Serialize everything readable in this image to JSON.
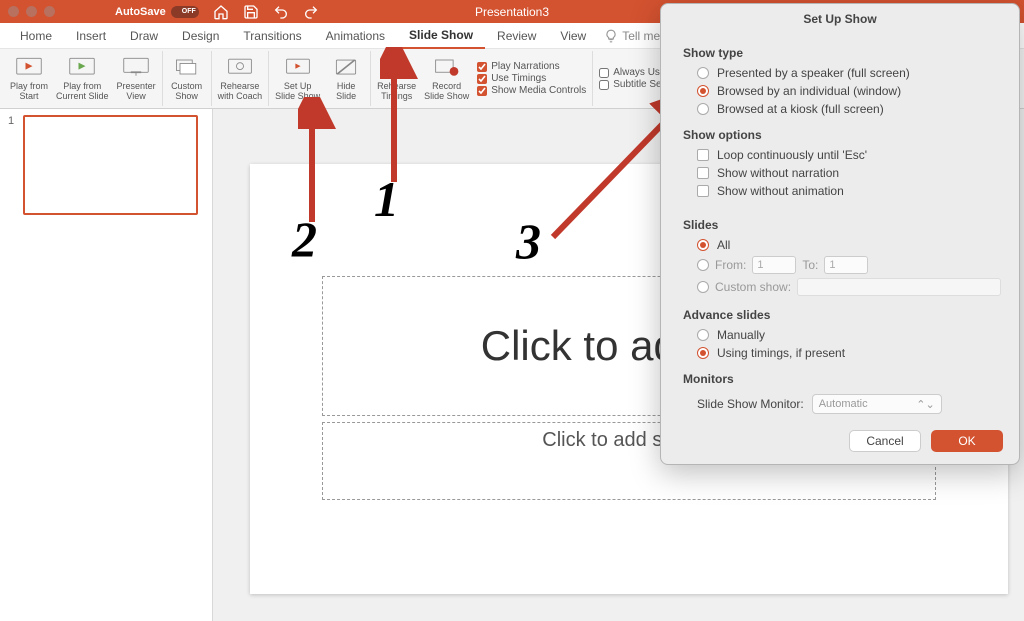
{
  "titlebar": {
    "autosave_label": "AutoSave",
    "autosave_state": "OFF",
    "doc_title": "Presentation3"
  },
  "menu": {
    "tabs": [
      "Home",
      "Insert",
      "Draw",
      "Design",
      "Transitions",
      "Animations",
      "Slide Show",
      "Review",
      "View"
    ],
    "active_index": 6,
    "tell_me": "Tell me"
  },
  "ribbon": {
    "play_from_start": "Play from\nStart",
    "play_from_current": "Play from\nCurrent Slide",
    "presenter_view": "Presenter\nView",
    "custom_show": "Custom\nShow",
    "rehearse_coach": "Rehearse\nwith Coach",
    "set_up": "Set Up\nSlide Show",
    "hide_slide": "Hide\nSlide",
    "rehearse_timings": "Rehearse\nTimings",
    "record": "Record\nSlide Show",
    "chk_narrations": "Play Narrations",
    "chk_timings": "Use Timings",
    "chk_media": "Show Media Controls",
    "chk_always": "Always Use",
    "chk_subtitle": "Subtitle Se"
  },
  "thumb": {
    "num": "1"
  },
  "canvas": {
    "title_placeholder": "Click to add title",
    "subtitle_placeholder": "Click to add subtitle"
  },
  "dialog": {
    "title": "Set Up Show",
    "show_type_hd": "Show type",
    "st_1": "Presented by a speaker (full screen)",
    "st_2": "Browsed by an individual (window)",
    "st_3": "Browsed at a kiosk (full screen)",
    "show_options_hd": "Show options",
    "so_1": "Loop continuously until 'Esc'",
    "so_2": "Show without narration",
    "so_3": "Show without animation",
    "slides_hd": "Slides",
    "slides_all": "All",
    "slides_from": "From:",
    "slides_from_val": "1",
    "slides_to": "To:",
    "slides_to_val": "1",
    "slides_custom": "Custom show:",
    "advance_hd": "Advance slides",
    "adv_1": "Manually",
    "adv_2": "Using timings, if present",
    "monitors_hd": "Monitors",
    "mon_label": "Slide Show Monitor:",
    "mon_value": "Automatic",
    "cancel": "Cancel",
    "ok": "OK"
  },
  "annot": {
    "n1": "1",
    "n2": "2",
    "n3": "3"
  }
}
